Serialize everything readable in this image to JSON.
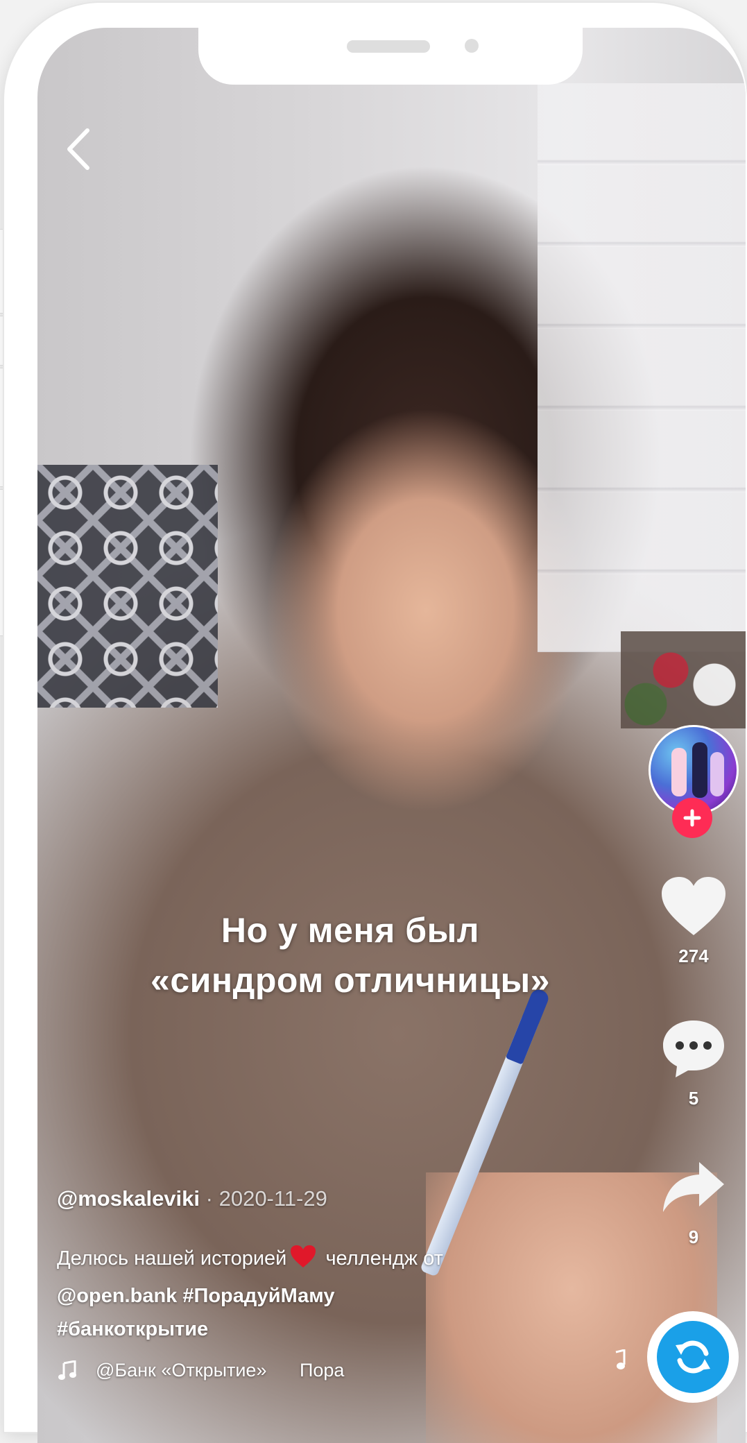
{
  "video": {
    "caption_line1": "Но у меня был",
    "caption_line2": "«синдром отличницы»"
  },
  "author": {
    "username": "@moskaleviki",
    "separator": "·",
    "date": "2020-11-29"
  },
  "description": {
    "text": "Делюсь нашей историей",
    "text_after_emoji": " челлендж от",
    "mention": "@open.bank",
    "hashtag1": "#ПорадуйМаму",
    "hashtag2": "#банкоткрытие"
  },
  "music": {
    "track": "@Банк «Открытие»",
    "track_next": "Пора"
  },
  "actions": {
    "likes": "274",
    "comments": "5",
    "shares": "9"
  },
  "colors": {
    "follow": "#fe2c55",
    "disc": "#1aa0e8",
    "heart_emoji": "#e0182a"
  }
}
